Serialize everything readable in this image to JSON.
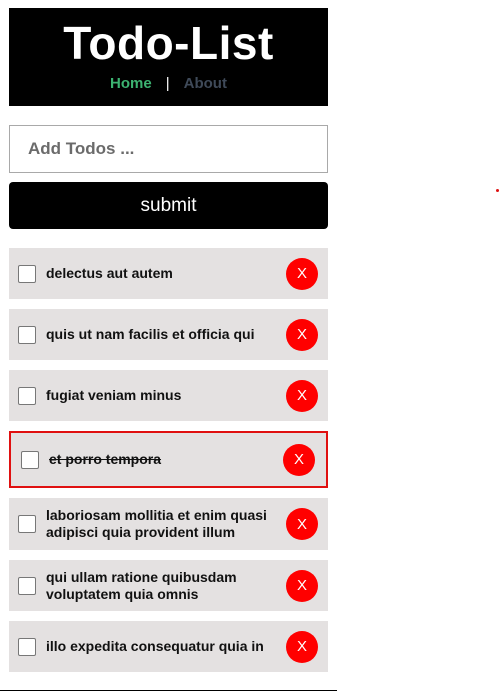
{
  "header": {
    "title": "Todo-List",
    "nav": {
      "home": "Home",
      "separator": "|",
      "about": "About"
    }
  },
  "form": {
    "input_placeholder": "Add Todos ...",
    "input_value": "",
    "submit_label": "submit"
  },
  "todos": [
    {
      "text": "delectus aut autem",
      "completed": false,
      "delete_label": "X"
    },
    {
      "text": "quis ut nam facilis et officia qui",
      "completed": false,
      "delete_label": "X"
    },
    {
      "text": "fugiat veniam minus",
      "completed": false,
      "delete_label": "X"
    },
    {
      "text": "et porro tempora",
      "completed": true,
      "delete_label": "X"
    },
    {
      "text": "laboriosam mollitia et enim quasi adipisci quia provident illum",
      "completed": false,
      "delete_label": "X"
    },
    {
      "text": "qui ullam ratione quibusdam voluptatem quia omnis",
      "completed": false,
      "delete_label": "X"
    },
    {
      "text": "illo expedita consequatur quia in",
      "completed": false,
      "delete_label": "X"
    }
  ],
  "colors": {
    "header_bg": "#000000",
    "home_link": "#3cb371",
    "about_link": "#3f4a59",
    "item_bg": "#e4e1e1",
    "delete_button": "#ff0000",
    "selected_border": "#e01010"
  }
}
